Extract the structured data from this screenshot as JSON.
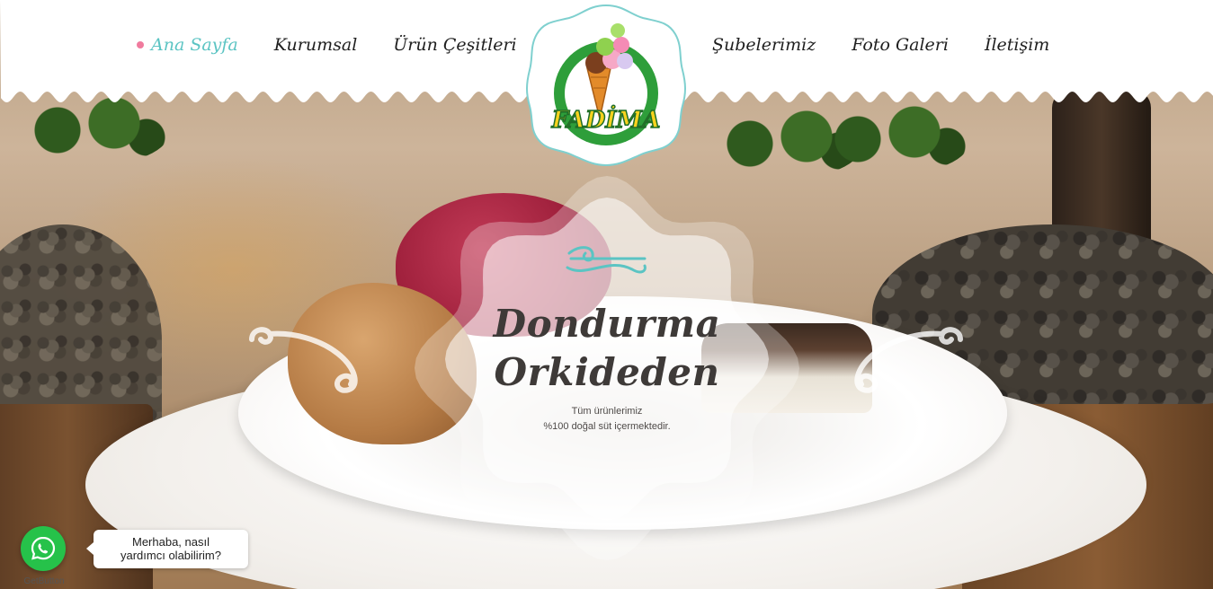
{
  "nav": {
    "left": [
      {
        "label": "Ana Sayfa",
        "active": true
      },
      {
        "label": "Kurumsal",
        "active": false
      },
      {
        "label": "Ürün Çeşitleri",
        "active": false
      }
    ],
    "right": [
      {
        "label": "Şubelerimiz",
        "active": false
      },
      {
        "label": "Foto Galeri",
        "active": false
      },
      {
        "label": "İletişim",
        "active": false
      }
    ]
  },
  "logo": {
    "text": "FADİMA"
  },
  "hero": {
    "title_line1": "Dondurma",
    "title_line2": "Orkideden",
    "subtitle_line1": "Tüm ürünlerimiz",
    "subtitle_line2": "%100 doğal süt içermektedir."
  },
  "whatsapp": {
    "message_line1": "Merhaba, nasıl",
    "message_line2": "yardımcı olabilirim?",
    "brand": "GetButton",
    "icon": "whatsapp-icon"
  },
  "colors": {
    "accent": "#5bc4c3",
    "active_dot": "#f07b9e",
    "logo_green": "#2e9e3a",
    "logo_yellow": "#f7d21e",
    "whatsapp_green": "#26c24a"
  }
}
